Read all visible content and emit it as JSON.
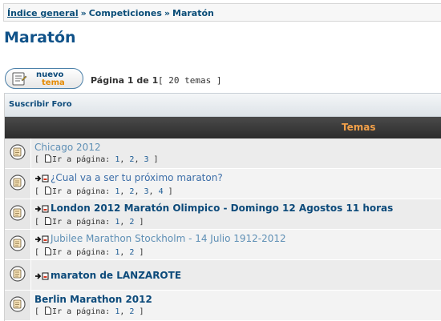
{
  "breadcrumb": {
    "items": [
      "Índice general",
      "Competiciones",
      "Maratón"
    ],
    "separator": "»"
  },
  "page_title": "Maratón",
  "new_topic_button": {
    "line1": "nuevo",
    "line2": "tema"
  },
  "pagination": {
    "text": "Página 1 de 1",
    "topics_count": "[ 20 temas ]"
  },
  "subscribe_link": "Suscribir Foro",
  "table_header": {
    "topics_label": "Temas"
  },
  "goto_label": "Ir a página:",
  "topics": [
    {
      "title": "Chicago 2012",
      "hot": false,
      "bold": false,
      "plain": true,
      "pages": [
        "1",
        "2",
        "3"
      ]
    },
    {
      "title": "¿Cual va a ser tu próximo maraton?",
      "hot": true,
      "bold": false,
      "plain": false,
      "pages": [
        "1",
        "2",
        "3",
        "4"
      ]
    },
    {
      "title": "London 2012 Maratón Olimpico - Domingo 12 Agostos 11 horas",
      "hot": true,
      "bold": true,
      "plain": false,
      "pages": [
        "1",
        "2"
      ]
    },
    {
      "title": "Jubilee Marathon Stockholm - 14 Julio 1912-2012",
      "hot": true,
      "bold": false,
      "plain": true,
      "pages": [
        "1",
        "2"
      ]
    },
    {
      "title": "maraton de LANZAROTE",
      "hot": true,
      "bold": true,
      "plain": false,
      "pages": []
    },
    {
      "title": "Berlin Marathon 2012",
      "hot": false,
      "bold": true,
      "plain": false,
      "pages": [
        "1",
        "2"
      ]
    }
  ]
}
